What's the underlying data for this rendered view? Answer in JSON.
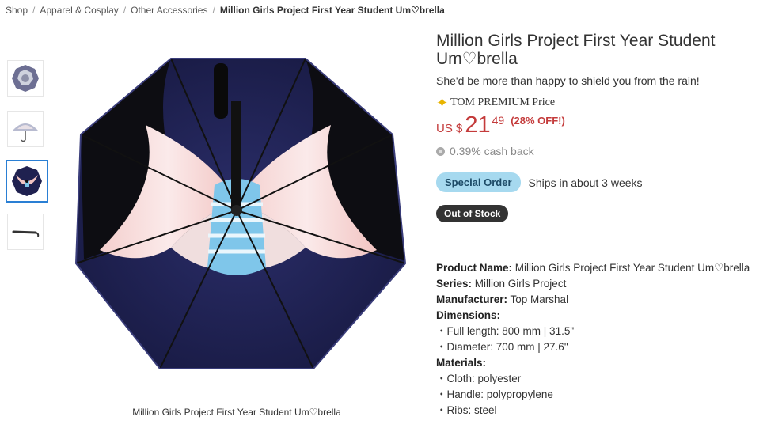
{
  "breadcrumb": {
    "items": [
      "Shop",
      "Apparel & Cosplay",
      "Other Accessories"
    ],
    "current": "Million Girls Project First Year Student Um♡brella"
  },
  "gallery": {
    "caption": "Million Girls Project First Year Student Um♡brella",
    "thumbnails": [
      "umbrella-top-view",
      "umbrella-side-view",
      "umbrella-inside-view",
      "umbrella-closed-view"
    ],
    "active_index": 2
  },
  "product": {
    "title": "Million Girls Project First Year Student Um♡brella",
    "tagline": "She'd be more than happy to shield you from the rain!",
    "premium_label": "TOM PREMIUM Price",
    "price_currency": "US $",
    "price_whole": "21",
    "price_cents": "49",
    "discount": "(28% OFF!)",
    "cashback": "0.39% cash back",
    "order_badge": "Special Order",
    "ships": "Ships in about 3 weeks",
    "stock_badge": "Out of Stock"
  },
  "specs": {
    "product_name_label": "Product Name:",
    "product_name": "Million Girls Project First Year Student Um♡brella",
    "series_label": "Series:",
    "series": "Million Girls Project",
    "manufacturer_label": "Manufacturer:",
    "manufacturer": "Top Marshal",
    "dimensions_label": "Dimensions:",
    "dimensions": [
      "・Full length: 800 mm | 31.5\"",
      "・Diameter: 700 mm | 27.6\""
    ],
    "materials_label": "Materials:",
    "materials": [
      "・Cloth: polyester",
      "・Handle: polypropylene",
      "・Ribs: steel"
    ]
  },
  "colors": {
    "price": "#c43b3b",
    "special_order_bg": "#a6d9ef",
    "stock_bg": "#333333",
    "umbrella_navy": "#1f2150",
    "umbrella_pink": "#f2c4c2",
    "umbrella_stripe": "#7fc6ea"
  }
}
